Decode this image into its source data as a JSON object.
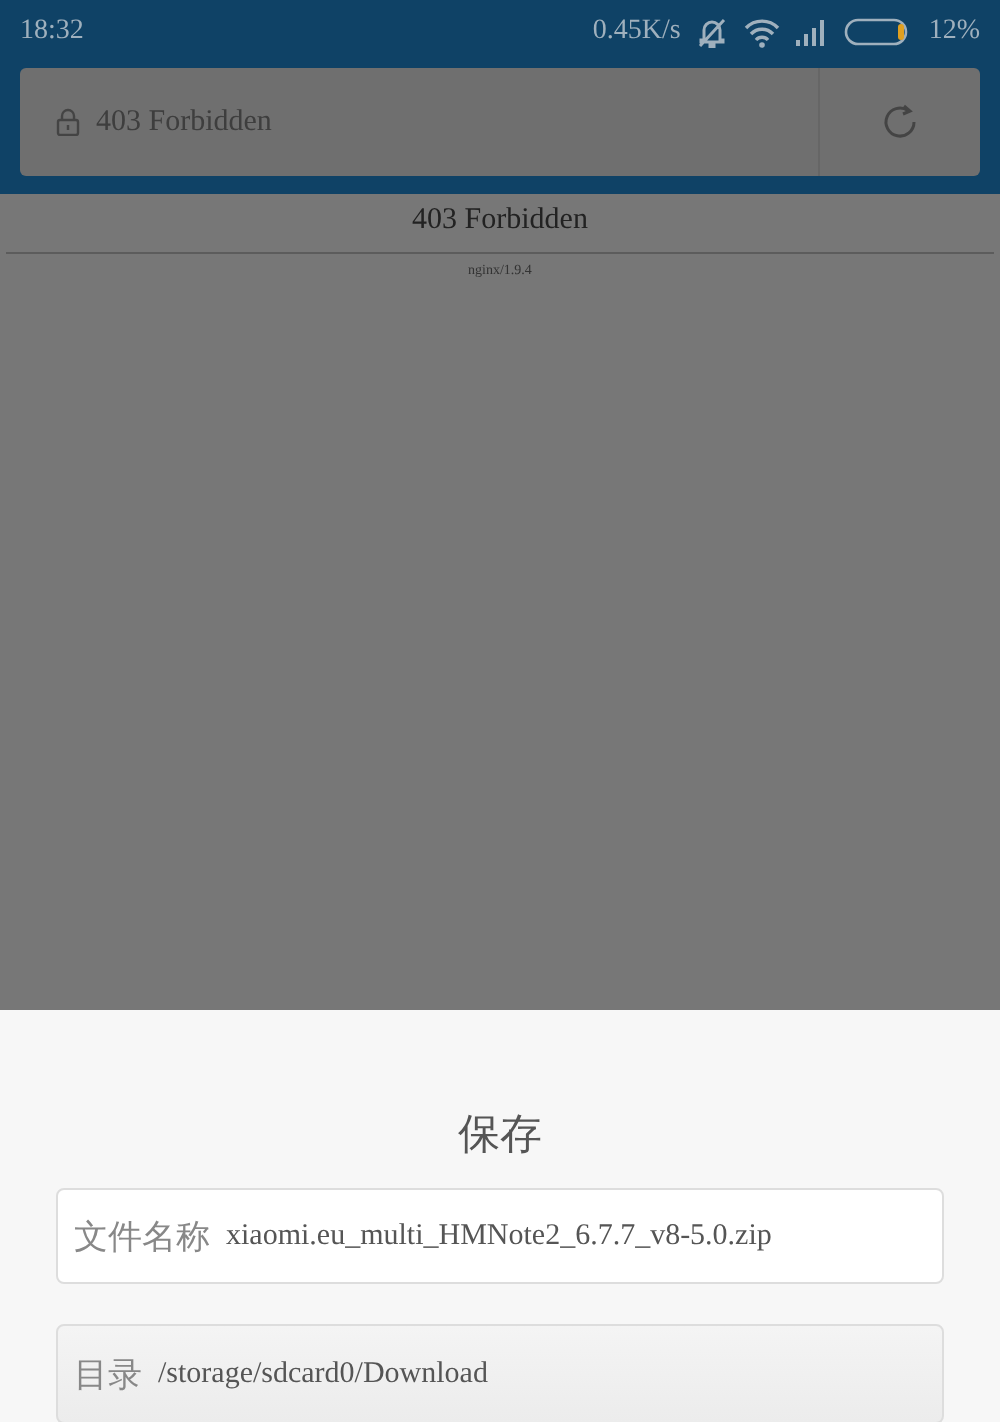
{
  "status_bar": {
    "time": "18:32",
    "network_speed": "0.45K/s",
    "battery_percent": "12%"
  },
  "address_bar": {
    "title": "403 Forbidden"
  },
  "page": {
    "heading": "403 Forbidden",
    "footer": "nginx/1.9.4"
  },
  "dialog": {
    "title": "保存",
    "fields": [
      {
        "kind": "input",
        "label": "文件名称",
        "value": "xiaomi.eu_multi_HMNote2_6.7.7_v8-5.0.zip"
      },
      {
        "kind": "picker",
        "label": "目录",
        "value": "/storage/sdcard0/Download"
      }
    ]
  }
}
